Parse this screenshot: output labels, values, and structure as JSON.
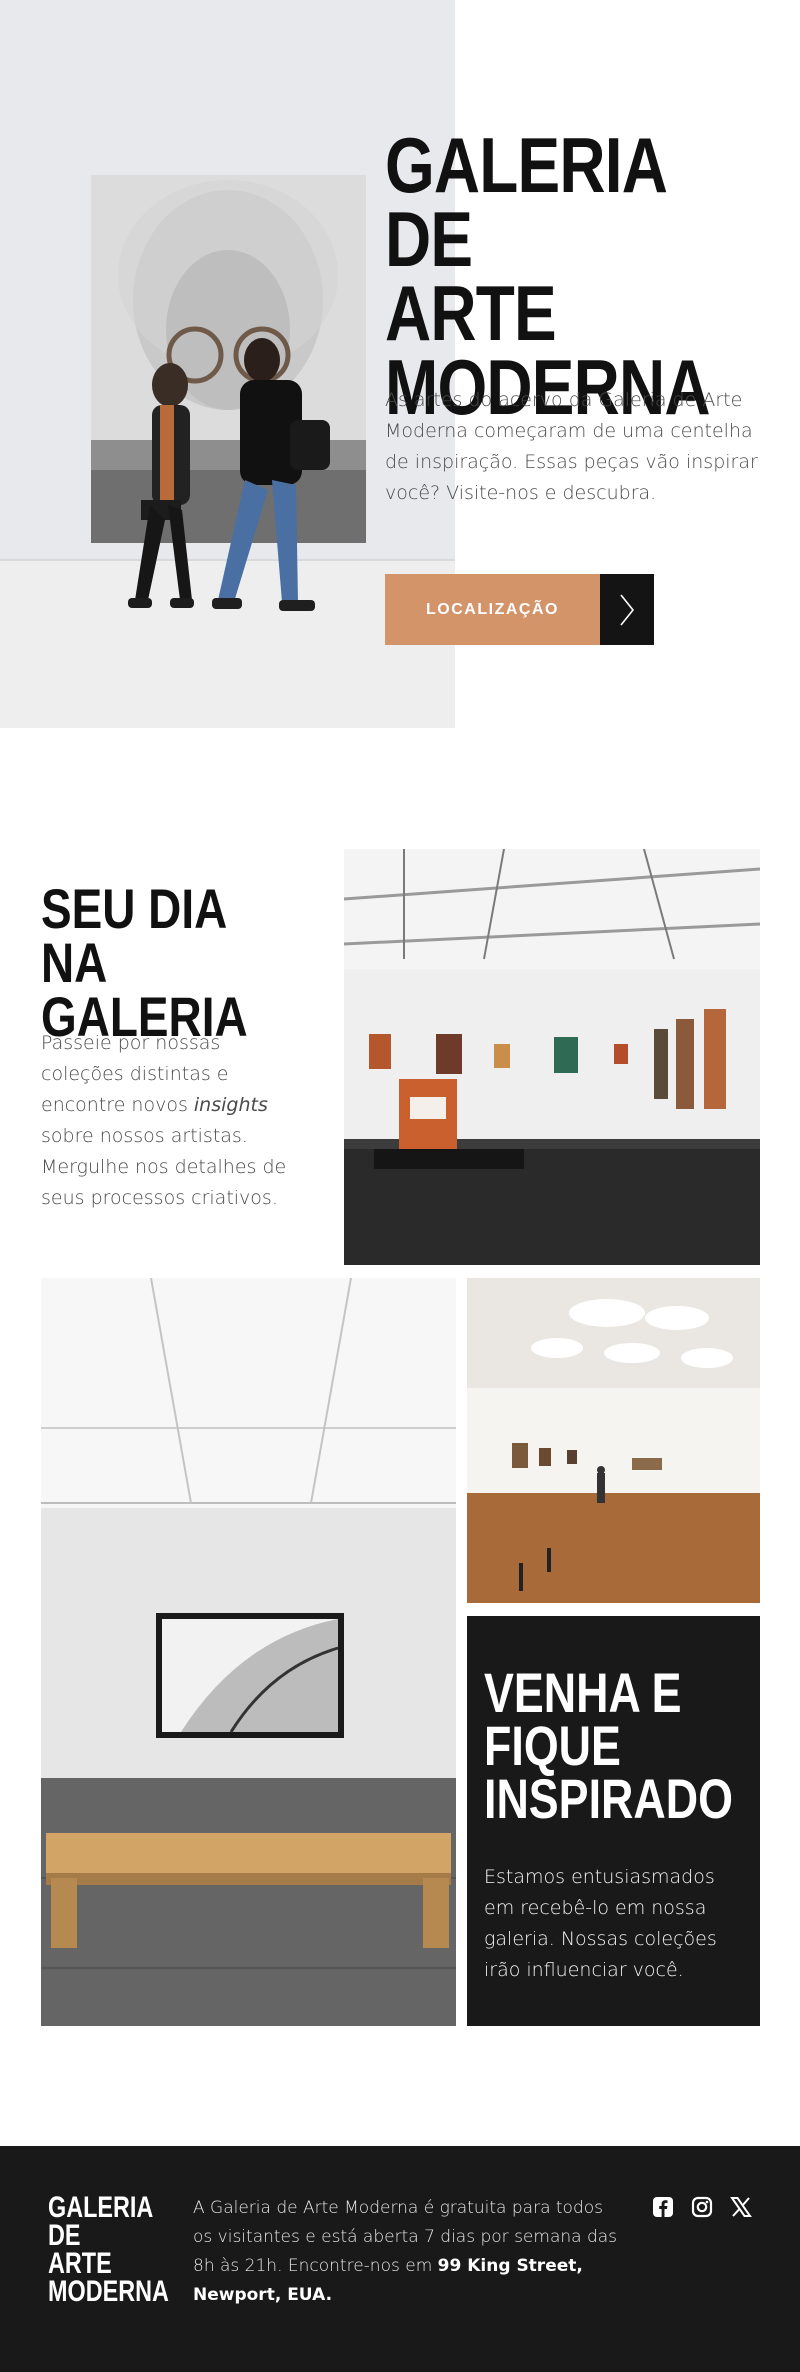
{
  "hero": {
    "title": "GALERIA DE\nARTE\nMODERNA",
    "description": "As artes do acervo da Galeria de Arte Moderna começaram de uma centelha de inspiração. Essas peças vão inspirar você? Visite-nos e descubra.",
    "cta_label": "LOCALIZAÇÃO",
    "cta_icon": "chevron-right-icon"
  },
  "day": {
    "title": "SEU DIA NA\nGALERIA",
    "text_before": "Passeie por nossas coleções distintas e encontre novos ",
    "text_emphasis": "insights",
    "text_after": " sobre nossos artistas. Mergulhe nos detalhes de seus processos criativos."
  },
  "inspired": {
    "title": "VENHA E\nFIQUE\nINSPIRADO",
    "text": "Estamos entusiasmados em recebê-lo em nossa galeria. Nossas coleções irão influenciar você."
  },
  "footer": {
    "logo": "GALERIA DE\nARTE\nMODERNA",
    "text_before": "A Galeria de Arte Moderna é gratuita para todos os visitantes e está aberta 7 dias por semana das 8h às 21h. Encontre-nos em ",
    "address": "99 King Street, Newport, EUA.",
    "social": [
      "facebook-icon",
      "instagram-icon",
      "x-icon"
    ]
  },
  "colors": {
    "accent": "#d4946a",
    "dark": "#191919",
    "text": "#4a4a4a"
  }
}
